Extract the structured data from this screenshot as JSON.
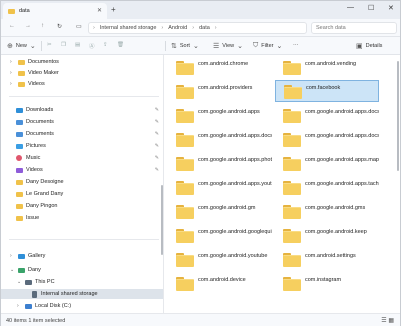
{
  "window": {
    "tab_title": "data",
    "tab_close": "✕",
    "new_tab": "+",
    "minimize": "—",
    "maximize": "☐",
    "close": "✕"
  },
  "address": {
    "back": "←",
    "forward": "→",
    "up": "↑",
    "refresh": "↻",
    "computer_icon": "▭",
    "path": [
      "Internal shared storage",
      "Android",
      "data"
    ],
    "search_placeholder": "Search data"
  },
  "toolbar": {
    "new": "New",
    "sort": "Sort",
    "view": "View",
    "filter": "Filter",
    "more": "···",
    "details": "Details"
  },
  "sidebar": {
    "folders_top": [
      {
        "label": "Documentos"
      },
      {
        "label": "Video Maker"
      },
      {
        "label": "Videos"
      }
    ],
    "quick_access": [
      {
        "label": "Downloads",
        "color": "#2f8fd8"
      },
      {
        "label": "Documents",
        "color": "#4a90d9"
      },
      {
        "label": "Documents",
        "color": "#4a90d9"
      },
      {
        "label": "Pictures",
        "color": "#3a9ee4"
      },
      {
        "label": "Music",
        "color": "#e0566d"
      },
      {
        "label": "Videos",
        "color": "#8e5cd9"
      },
      {
        "label": "Dany Desoigne",
        "color": "#f0c24a"
      },
      {
        "label": "Le Grand Dany",
        "color": "#f0c24a"
      },
      {
        "label": "Dany Pingon",
        "color": "#f0c24a"
      },
      {
        "label": "Issue",
        "color": "#f0c24a"
      }
    ],
    "bottom": [
      {
        "label": "Gallery",
        "expanded": false
      },
      {
        "label": "Dany",
        "expanded": true
      },
      {
        "label": "This PC",
        "expanded": true
      },
      {
        "label": "Internal shared storage",
        "selected": true
      },
      {
        "label": "Local Disk (C:)",
        "expanded": false
      }
    ]
  },
  "folders": [
    {
      "name": "com.android.chrome",
      "selected": false
    },
    {
      "name": "com.android.vending",
      "selected": false
    },
    {
      "name": "com.android.providers",
      "selected": false
    },
    {
      "name": "com.facebook",
      "selected": true
    },
    {
      "name": "com.google.android.apps",
      "selected": false
    },
    {
      "name": "com.google.android.apps.docs",
      "selected": false
    },
    {
      "name": "com.google.android.apps.docs",
      "selected": false
    },
    {
      "name": "com.google.android.apps.docs.editors",
      "selected": false
    },
    {
      "name": "com.google.android.apps.photos",
      "selected": false
    },
    {
      "name": "com.google.android.apps.maps",
      "selected": false
    },
    {
      "name": "com.google.android.apps.youtube",
      "selected": false
    },
    {
      "name": "com.google.android.apps.tachyon",
      "selected": false
    },
    {
      "name": "com.google.android.gm",
      "selected": false
    },
    {
      "name": "com.google.android.gms",
      "selected": false
    },
    {
      "name": "com.google.android.googlequicksearchbox",
      "selected": false
    },
    {
      "name": "com.google.android.keep",
      "selected": false
    },
    {
      "name": "com.google.android.youtube",
      "selected": false
    },
    {
      "name": "com.android.settings",
      "selected": false
    },
    {
      "name": "com.android.device",
      "selected": false
    },
    {
      "name": "com.instagram",
      "selected": false
    }
  ],
  "status": {
    "text": "40 items  1 item selected"
  }
}
